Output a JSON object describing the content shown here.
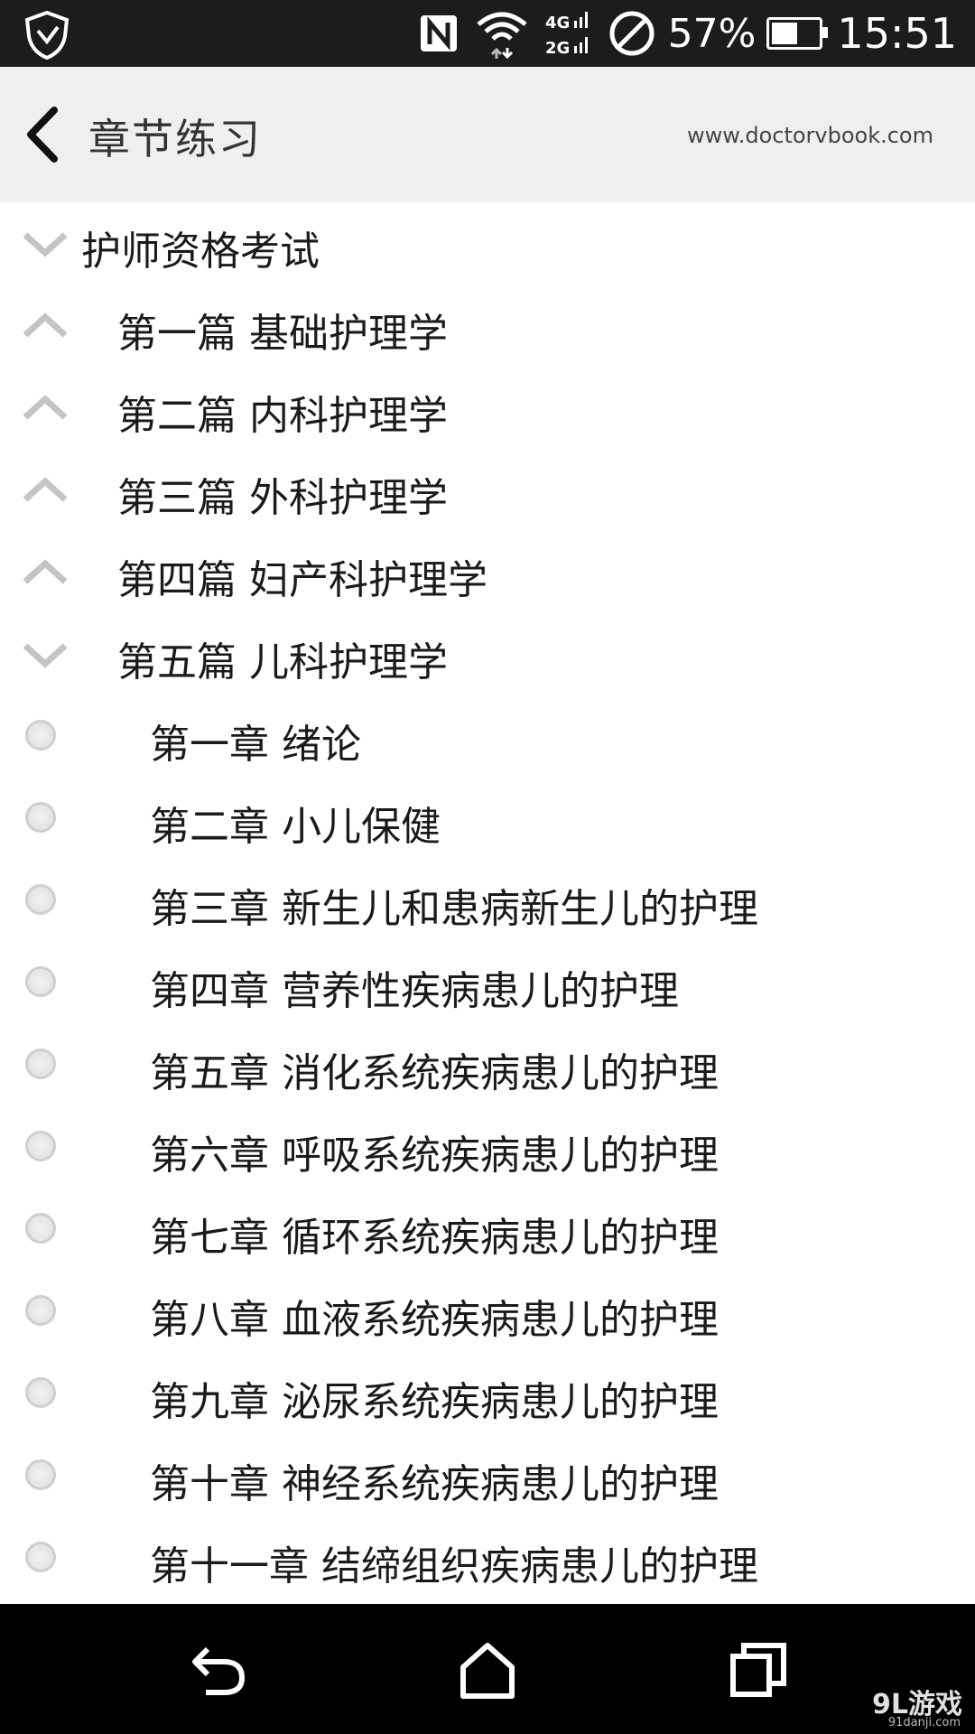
{
  "status_bar": {
    "battery_percent": "57%",
    "battery_level": 0.57,
    "time": "15:51",
    "icons": [
      "shield-icon",
      "nfc-icon",
      "wifi-icon",
      "signal-4g-icon",
      "signal-2g-icon",
      "do-not-disturb-icon",
      "battery-icon"
    ]
  },
  "header": {
    "title": "章节练习",
    "website": "www.doctorvbook.com"
  },
  "tree": {
    "root": {
      "label": "护师资格考试",
      "expanded": true
    },
    "parts": [
      {
        "label": "第一篇 基础护理学",
        "expanded": false
      },
      {
        "label": "第二篇 内科护理学",
        "expanded": false
      },
      {
        "label": "第三篇 外科护理学",
        "expanded": false
      },
      {
        "label": "第四篇 妇产科护理学",
        "expanded": false
      },
      {
        "label": "第五篇 儿科护理学",
        "expanded": true
      }
    ],
    "chapters": [
      "第一章 绪论",
      "第二章 小儿保健",
      "第三章 新生儿和患病新生儿的护理",
      "第四章 营养性疾病患儿的护理",
      "第五章 消化系统疾病患儿的护理",
      "第六章 呼吸系统疾病患儿的护理",
      "第七章 循环系统疾病患儿的护理",
      "第八章 血液系统疾病患儿的护理",
      "第九章 泌尿系统疾病患儿的护理",
      "第十章 神经系统疾病患儿的护理",
      "第十一章 结缔组织疾病患儿的护理"
    ]
  },
  "nav_bar": {
    "icons": [
      "back-icon",
      "home-icon",
      "recents-icon"
    ]
  },
  "watermark": {
    "text": "9L游戏",
    "sub": "91danji.com"
  },
  "colors": {
    "status_bar_bg": "#1c1c1c",
    "header_bg": "#efefef",
    "nav_bar_bg": "#000000",
    "arrow_color": "#c4c4c4",
    "radio_border": "#cfcfcf"
  }
}
